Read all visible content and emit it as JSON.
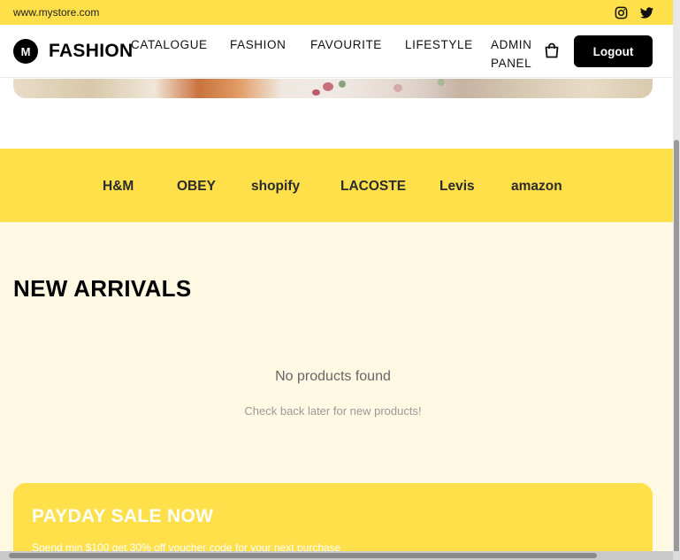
{
  "topbar": {
    "url": "www.mystore.com",
    "social": [
      {
        "icon": "instagram-icon"
      },
      {
        "icon": "twitter-icon"
      }
    ]
  },
  "navbar": {
    "logo_letter": "M",
    "brand": "FASHION",
    "links": [
      "CATALOGUE",
      "FASHION",
      "FAVOURITE",
      "LIFESTYLE",
      "ADMIN PANEL"
    ],
    "cart_icon": "shopping-bag-icon",
    "logout_label": "Logout"
  },
  "brands": [
    "H&M",
    "OBEY",
    "shopify",
    "LACOSTE",
    "Levis",
    "amazon"
  ],
  "new_arrivals": {
    "title": "NEW ARRIVALS",
    "empty_title": "No products found",
    "empty_subtitle": "Check back later for new products!"
  },
  "sale_banner": {
    "title": "PAYDAY SALE NOW",
    "text": "Spend min $100 get 30% off voucher code for your next purchase"
  },
  "colors": {
    "accent": "#ffe04b",
    "arrivals_bg": "#fff9e4",
    "button_bg": "#000000"
  }
}
